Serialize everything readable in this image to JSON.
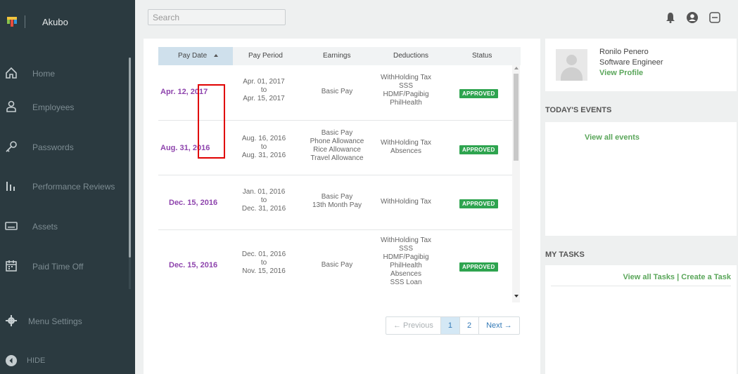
{
  "app": {
    "name": "Akubo"
  },
  "sidebar": {
    "items": [
      {
        "label": "Home",
        "icon": "home-icon"
      },
      {
        "label": "Employees",
        "icon": "user-icon"
      },
      {
        "label": "Passwords",
        "icon": "key-icon"
      },
      {
        "label": "Performance Reviews",
        "icon": "bar-chart-icon"
      },
      {
        "label": "Assets",
        "icon": "keyboard-icon"
      },
      {
        "label": "Paid Time Off",
        "icon": "calendar-icon"
      }
    ],
    "settings_label": "Menu Settings",
    "hide_label": "HIDE"
  },
  "search": {
    "placeholder": "Search"
  },
  "table": {
    "headers": [
      "Pay Date",
      "Pay Period",
      "Earnings",
      "Deductions",
      "Status"
    ],
    "rows": [
      {
        "pay_date": "Apr. 12, 2017",
        "period": [
          "Apr. 01, 2017",
          "to",
          "Apr. 15, 2017"
        ],
        "earnings": [
          "Basic Pay"
        ],
        "deductions": [
          "WithHolding Tax",
          "SSS",
          "HDMF/Pagibig",
          "PhilHealth"
        ],
        "status": "APPROVED"
      },
      {
        "pay_date": "Aug. 31, 2016",
        "period": [
          "Aug. 16, 2016",
          "to",
          "Aug. 31, 2016"
        ],
        "earnings": [
          "Basic Pay",
          "Phone Allowance",
          "Rice Allowance",
          "Travel Allowance"
        ],
        "deductions": [
          "WithHolding Tax",
          "Absences"
        ],
        "status": "APPROVED"
      },
      {
        "pay_date": "Dec. 15, 2016",
        "period": [
          "Jan. 01, 2016",
          "to",
          "Dec. 31, 2016"
        ],
        "earnings": [
          "Basic Pay",
          "13th Month Pay"
        ],
        "deductions": [
          "WithHolding Tax"
        ],
        "status": "APPROVED"
      },
      {
        "pay_date": "Dec. 15, 2016",
        "period": [
          "Dec. 01, 2016",
          "to",
          "Nov. 15, 2016"
        ],
        "earnings": [
          "Basic Pay"
        ],
        "deductions": [
          "WithHolding Tax",
          "SSS",
          "HDMF/Pagibig",
          "PhilHealth",
          "Absences",
          "SSS Loan"
        ],
        "status": "APPROVED"
      }
    ]
  },
  "pagination": {
    "previous": "← Previous",
    "pages": [
      "1",
      "2"
    ],
    "next": "Next →"
  },
  "profile": {
    "name": "Ronilo Penero",
    "role": "Software Engineer",
    "link": "View Profile"
  },
  "events": {
    "title": "TODAY'S EVENTS",
    "link": "View all events"
  },
  "tasks": {
    "title": "MY TASKS",
    "view_link": "View all Tasks",
    "separator": "|",
    "create_link": "Create a Task"
  },
  "colors": {
    "sidebar_bg": "#2b3a40",
    "accent_green": "#5aa65a",
    "pay_date_purple": "#8e44ad",
    "approved_badge": "#2ea44f"
  }
}
